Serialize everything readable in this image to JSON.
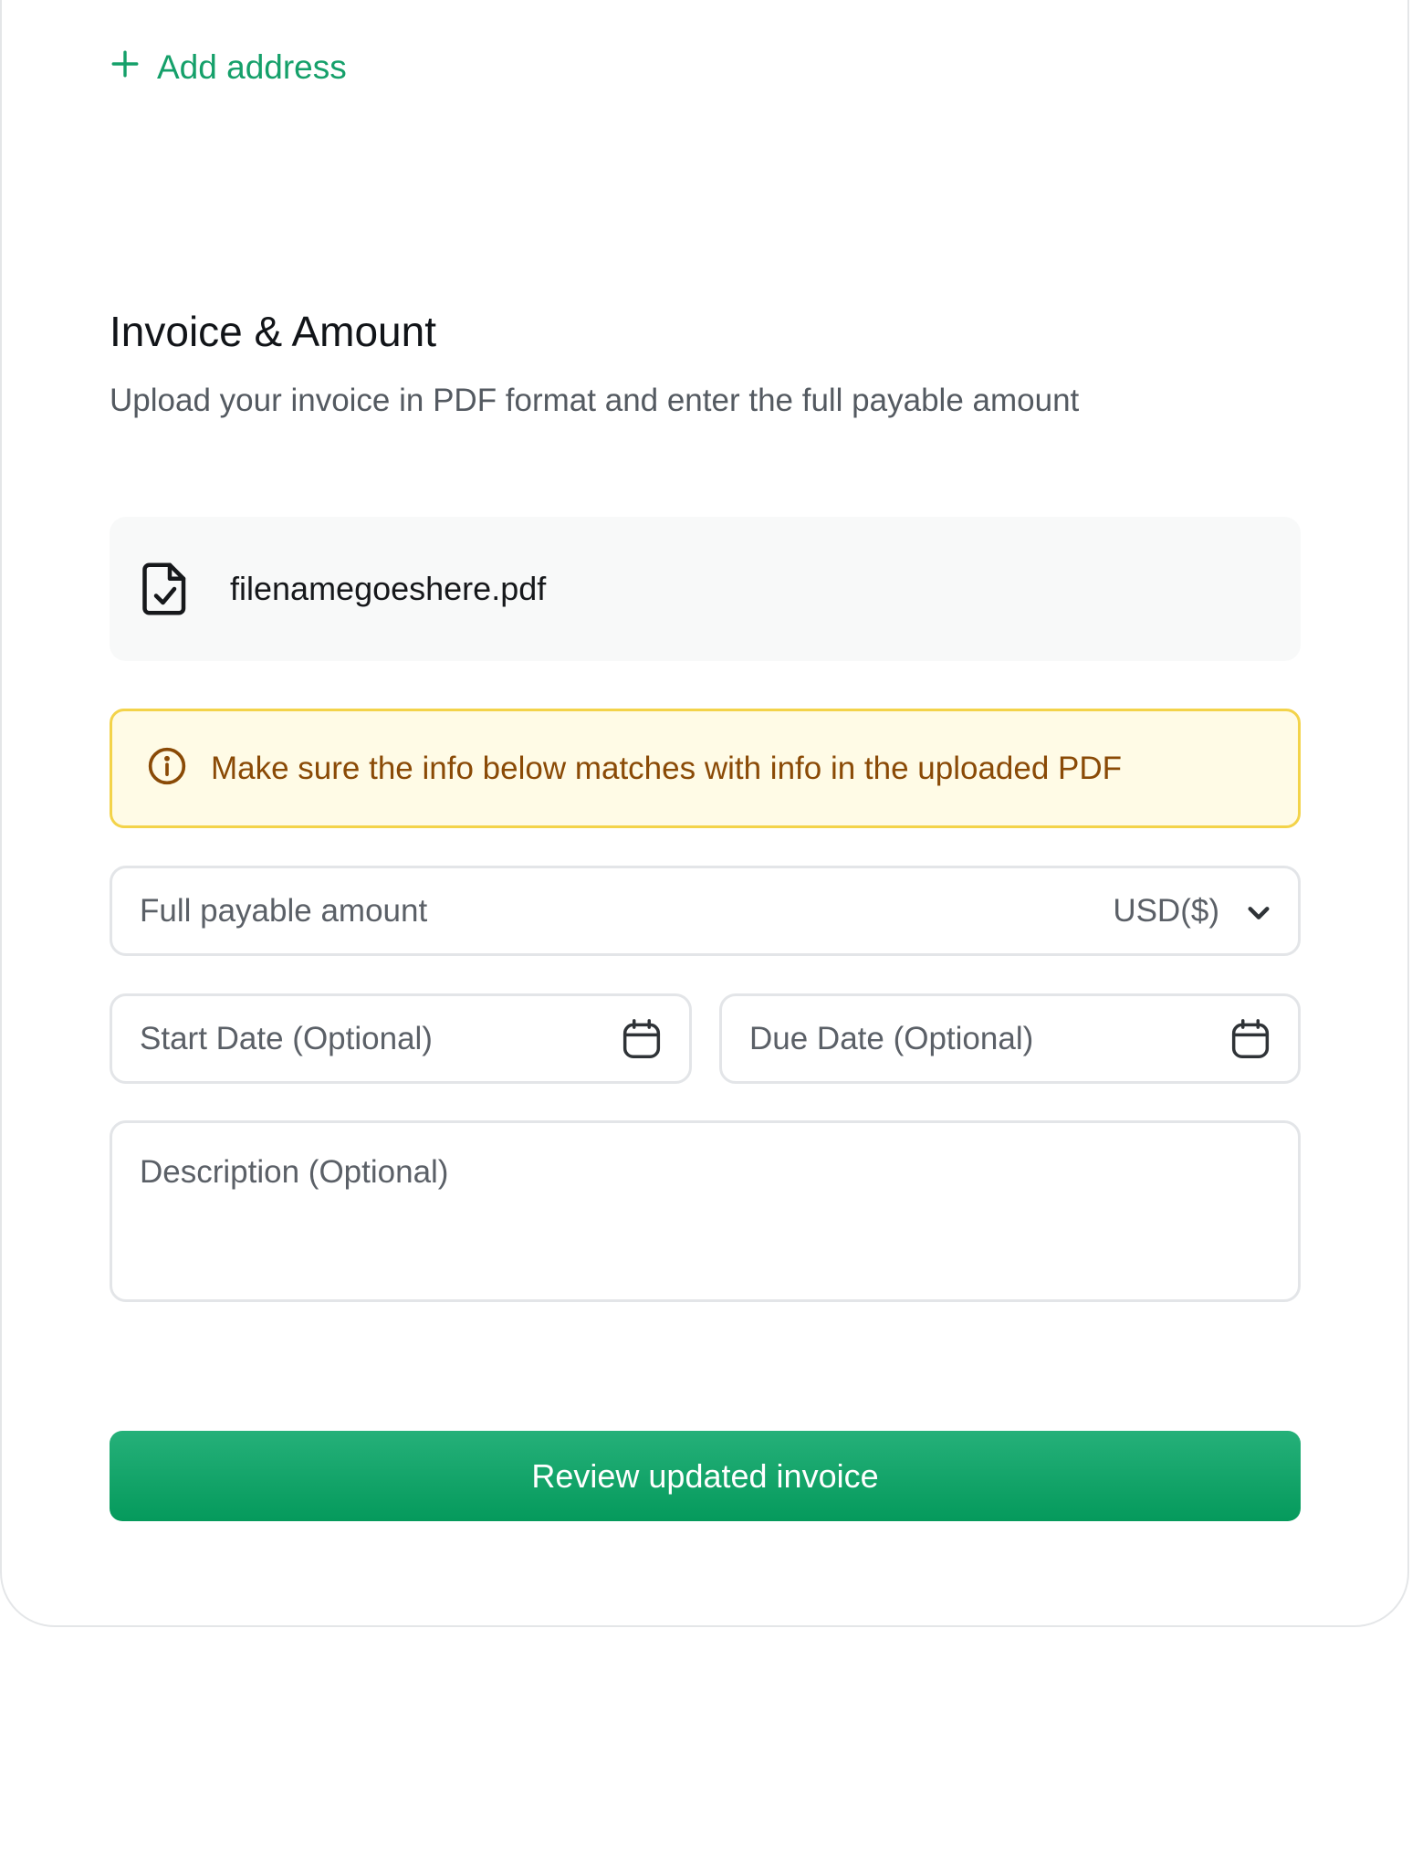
{
  "address": {
    "add_label": "Add address"
  },
  "invoice_section": {
    "title": "Invoice & Amount",
    "subtitle": "Upload your invoice in PDF format and enter the full payable amount"
  },
  "file": {
    "name": "filenamegoeshere.pdf",
    "icon": "file-check-icon"
  },
  "notice": {
    "icon": "info-icon",
    "text": "Make sure the info below matches with info in the uploaded PDF",
    "colors": {
      "background": "#fffbe6",
      "border": "#f3d34a",
      "text": "#8a4a06"
    }
  },
  "form": {
    "amount_placeholder": "Full payable amount",
    "currency": "USD($)",
    "start_date_placeholder": "Start Date (Optional)",
    "due_date_placeholder": "Due Date (Optional)",
    "description_placeholder": "Description (Optional)"
  },
  "cta": {
    "label": "Review updated invoice"
  },
  "colors": {
    "accent": "#15a06a",
    "button": "#059a5c"
  }
}
